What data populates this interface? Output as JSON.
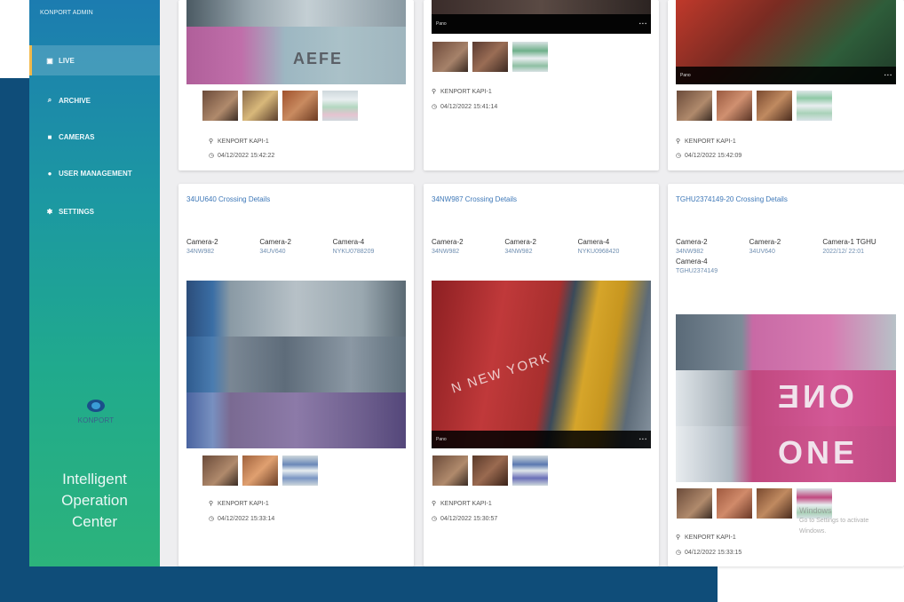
{
  "sidebar": {
    "title": "KONPORT ADMIN",
    "items": [
      {
        "label": "LIVE",
        "icon": "monitor-icon",
        "active": true
      },
      {
        "label": "ARCHIVE",
        "icon": "search-icon",
        "active": false
      },
      {
        "label": "CAMERAS",
        "icon": "camera-icon",
        "active": false
      },
      {
        "label": "USER MANAGEMENT",
        "icon": "user-icon",
        "active": false
      },
      {
        "label": "SETTINGS",
        "icon": "gear-icon",
        "active": false
      }
    ],
    "logo_text": "KONPORT",
    "product_line1": "Intelligent",
    "product_line2": "Operation",
    "product_line3": "Center"
  },
  "cards_top": [
    {
      "location": "KENPORT KAPI-1",
      "datetime": "04/12/2022 15:42:22"
    },
    {
      "location": "KENPORT KAPI-1",
      "datetime": "04/12/2022 15:41:14"
    },
    {
      "location": "KENPORT KAPI-1",
      "datetime": "04/12/2022 15:42:09"
    }
  ],
  "cards_bottom": [
    {
      "title": "34UU640 Crossing Details",
      "cameras": [
        {
          "label": "Camera-2",
          "value": "34NW982"
        },
        {
          "label": "Camera-2",
          "value": "34UV640"
        },
        {
          "label": "Camera-4",
          "value": "NYKU0788209"
        }
      ],
      "location": "KENPORT KAPI-1",
      "datetime": "04/12/2022 15:33:14"
    },
    {
      "title": "34NW987 Crossing Details",
      "cameras": [
        {
          "label": "Camera-2",
          "value": "34NW982"
        },
        {
          "label": "Camera-2",
          "value": "34NW982"
        },
        {
          "label": "Camera-4",
          "value": "NYKU0968420"
        }
      ],
      "location": "KENPORT KAPI-1",
      "datetime": "04/12/2022 15:30:57"
    },
    {
      "title": "TGHU2374149-20 Crossing Details",
      "cameras": [
        {
          "label": "Camera-2",
          "value": "34NW982"
        },
        {
          "label": "Camera-2",
          "value": "34UV640"
        },
        {
          "label": "Camera-1 TGHU",
          "value": "2022/12/ 22:01"
        },
        {
          "label": "Camera-4",
          "value": "TGHU2374149"
        }
      ],
      "location": "KENPORT KAPI-1",
      "datetime": "04/12/2022 15:33:15"
    }
  ],
  "watermark": {
    "line1": "Windows",
    "line2": "Go to Settings to activate Windows."
  }
}
